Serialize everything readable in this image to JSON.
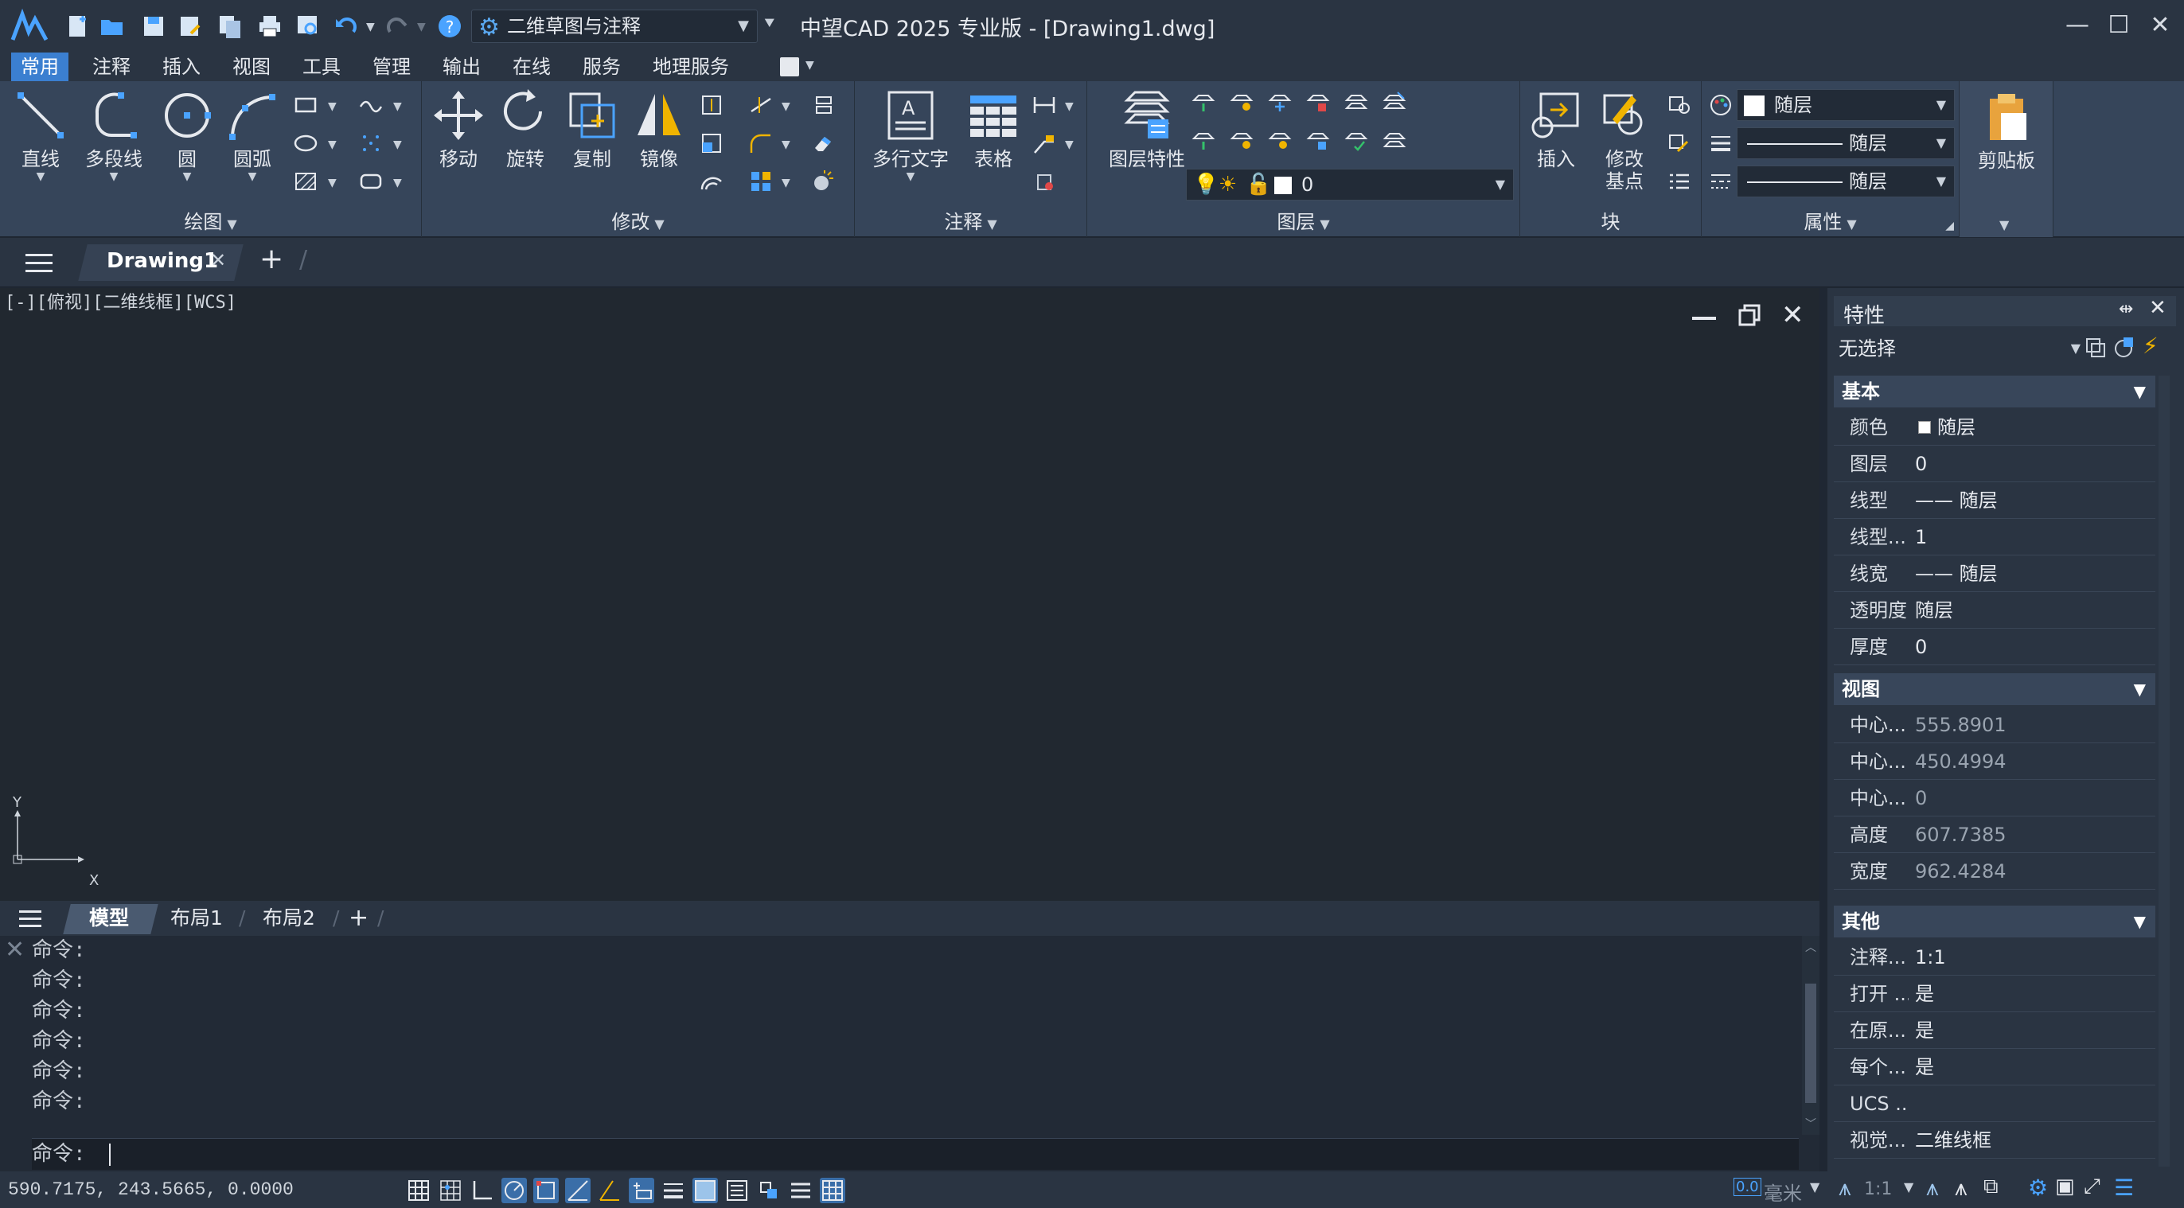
{
  "app": {
    "title": "中望CAD 2025 专业版 - [Drawing1.dwg]",
    "workspace": "二维草图与注释"
  },
  "menu": [
    "常用",
    "注释",
    "插入",
    "视图",
    "工具",
    "管理",
    "输出",
    "在线",
    "服务",
    "地理服务"
  ],
  "ribbon": {
    "draw": {
      "title": "绘图",
      "line": "直线",
      "polyline": "多段线",
      "circle": "圆",
      "arc": "圆弧"
    },
    "modify": {
      "title": "修改",
      "move": "移动",
      "rotate": "旋转",
      "copy": "复制",
      "mirror": "镜像"
    },
    "annotate": {
      "title": "注释",
      "mtext": "多行文字",
      "table": "表格"
    },
    "layers": {
      "title": "图层",
      "props": "图层特性",
      "current": "0"
    },
    "block": {
      "title": "块",
      "insert": "插入",
      "basepoint_line1": "修改",
      "basepoint_line2": "基点"
    },
    "properties": {
      "title": "属性",
      "color": "随层",
      "linetype": "随层",
      "lineweight": "随层"
    },
    "clipboard": {
      "title": "剪贴板"
    }
  },
  "doc": {
    "tab": "Drawing1",
    "close": "✕",
    "add": "+"
  },
  "canvas": {
    "viewlabel": "[-][俯视][二维线框][WCS]",
    "axis_y": "Y",
    "axis_x": "X"
  },
  "layouts": [
    "模型",
    "布局1",
    "布局2"
  ],
  "command": {
    "history": [
      "命令:",
      "命令:",
      "命令:",
      "命令:",
      "命令:",
      "命令:"
    ],
    "prompt": "命令:"
  },
  "status": {
    "coords": "590.7175, 243.5665, 0.0000",
    "unit": "毫米",
    "scale": "1:1"
  },
  "props": {
    "title": "特性",
    "selection": "无选择",
    "sections": {
      "basic": "基本",
      "view": "视图",
      "other": "其他"
    },
    "basic": [
      {
        "k": "颜色",
        "v": "随层"
      },
      {
        "k": "图层",
        "v": "0"
      },
      {
        "k": "线型",
        "v": "—— 随层"
      },
      {
        "k": "线型...",
        "v": "1"
      },
      {
        "k": "线宽",
        "v": "—— 随层"
      },
      {
        "k": "透明度",
        "v": "随层"
      },
      {
        "k": "厚度",
        "v": "0"
      }
    ],
    "view": [
      {
        "k": "中心...",
        "v": "555.8901"
      },
      {
        "k": "中心...",
        "v": "450.4994"
      },
      {
        "k": "中心...",
        "v": "0"
      },
      {
        "k": "高度",
        "v": "607.7385"
      },
      {
        "k": "宽度",
        "v": "962.4284"
      }
    ],
    "other": [
      {
        "k": "注释...",
        "v": "1:1"
      },
      {
        "k": "打开 ...",
        "v": "是"
      },
      {
        "k": "在原...",
        "v": "是"
      },
      {
        "k": "每个...",
        "v": "是"
      },
      {
        "k": "UCS ...",
        "v": ""
      },
      {
        "k": "视觉...",
        "v": "二维线框"
      }
    ]
  },
  "colors": {
    "accent": "#3b7fd0",
    "bg": "#212830",
    "ribbon": "#36455a"
  }
}
